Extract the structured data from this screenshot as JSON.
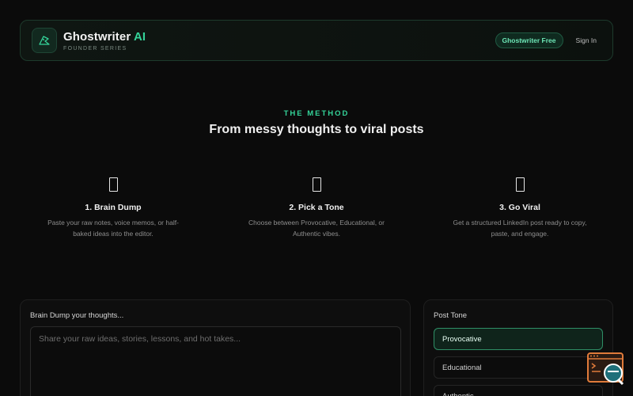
{
  "header": {
    "title_main": "Ghostwriter",
    "title_accent": "AI",
    "subtitle": "FOUNDER SERIES",
    "plan_badge": "Ghostwriter Free",
    "sign_in": "Sign In"
  },
  "method": {
    "eyebrow": "THE METHOD",
    "title": "From messy thoughts to viral posts",
    "steps": [
      {
        "icon": "document-icon",
        "title": "1. Brain Dump",
        "desc_line1": "Paste your raw notes, voice memos, or half-",
        "desc_line2": "baked ideas into the editor."
      },
      {
        "icon": "tone-icon",
        "title": "2. Pick a Tone",
        "desc_line1": "Choose between Provocative, Educational, or",
        "desc_line2": "Authentic vibes."
      },
      {
        "icon": "rocket-icon",
        "title": "3. Go Viral",
        "desc_line1": "Get a structured LinkedIn post ready to copy,",
        "desc_line2": "paste, and engage."
      }
    ]
  },
  "editor": {
    "label": "Brain Dump your thoughts...",
    "placeholder": "Share your raw ideas, stories, lessons, and hot takes..."
  },
  "tone": {
    "label": "Post Tone",
    "options": [
      "Provocative",
      "Educational",
      "Authentic"
    ],
    "selected": "Provocative"
  },
  "colors": {
    "accent": "#34d399",
    "background": "#0b0b0b",
    "widget_orange": "#e07b3a",
    "widget_teal": "#1f6f7a"
  }
}
